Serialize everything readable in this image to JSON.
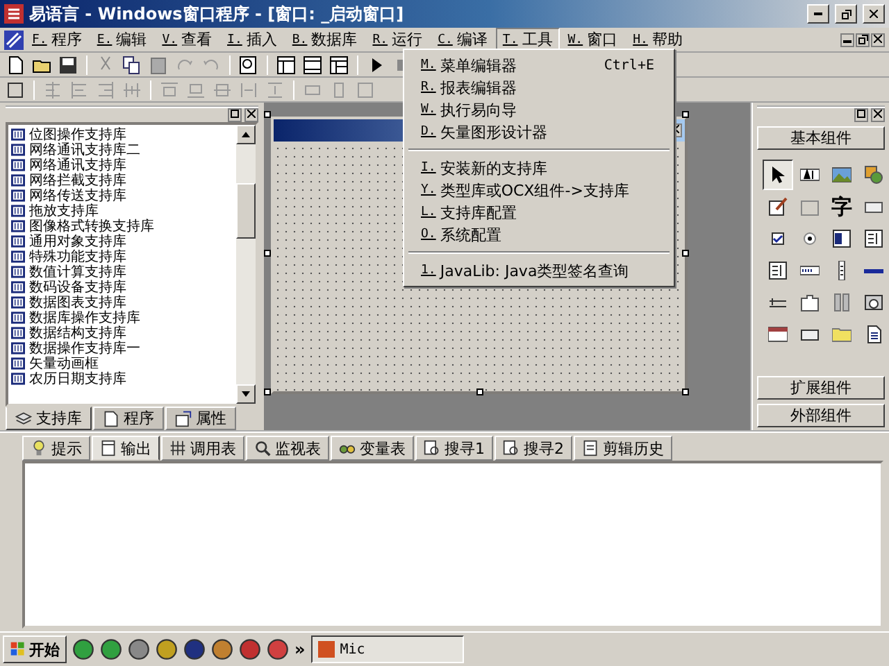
{
  "window": {
    "title": "易语言 - Windows窗口程序 - [窗口: _启动窗口]"
  },
  "menus": [
    {
      "key": "F.",
      "label": "程序",
      "selected": false
    },
    {
      "key": "E.",
      "label": "编辑",
      "selected": false
    },
    {
      "key": "V.",
      "label": "查看",
      "selected": false
    },
    {
      "key": "I.",
      "label": "插入",
      "selected": false
    },
    {
      "key": "B.",
      "label": "数据库",
      "selected": false
    },
    {
      "key": "R.",
      "label": "运行",
      "selected": false
    },
    {
      "key": "C.",
      "label": "编译",
      "selected": false
    },
    {
      "key": "T.",
      "label": "工具",
      "selected": true
    },
    {
      "key": "W.",
      "label": "窗口",
      "selected": false
    },
    {
      "key": "H.",
      "label": "帮助",
      "selected": false
    }
  ],
  "tools_menu": [
    {
      "kind": "item",
      "key": "M.",
      "label": "菜单编辑器",
      "shortcut": "Ctrl+E"
    },
    {
      "kind": "item",
      "key": "R.",
      "label": "报表编辑器"
    },
    {
      "kind": "item",
      "key": "W.",
      "label": "执行易向导"
    },
    {
      "kind": "item",
      "key": "D.",
      "label": "矢量图形设计器"
    },
    {
      "kind": "separator"
    },
    {
      "kind": "item",
      "key": "I.",
      "label": "安装新的支持库"
    },
    {
      "kind": "item",
      "key": "Y.",
      "label": "类型库或OCX组件->支持库"
    },
    {
      "kind": "item",
      "key": "L.",
      "label": "支持库配置"
    },
    {
      "kind": "item",
      "key": "O.",
      "label": "系统配置"
    },
    {
      "kind": "separator"
    },
    {
      "kind": "item",
      "key": "1.",
      "label": "JavaLib: Java类型签名查询"
    }
  ],
  "library_panel": {
    "items": [
      "位图操作支持库",
      "网络通讯支持库二",
      "网络通讯支持库",
      "网络拦截支持库",
      "网络传送支持库",
      "拖放支持库",
      "图像格式转换支持库",
      "通用对象支持库",
      "特殊功能支持库",
      "数值计算支持库",
      "数码设备支持库",
      "数据图表支持库",
      "数据库操作支持库",
      "数据结构支持库",
      "数据操作支持库一",
      "矢量动画框",
      "农历日期支持库"
    ],
    "tabs": [
      {
        "label": "支持库",
        "selected": true
      },
      {
        "label": "程序",
        "selected": false
      },
      {
        "label": "属性",
        "selected": false
      }
    ]
  },
  "palette": {
    "basic": "基本组件",
    "items": [
      {
        "kind": "pointer",
        "selected": true
      },
      {
        "kind": "label",
        "selected": false
      },
      {
        "kind": "picture",
        "selected": false
      },
      {
        "kind": "shapes",
        "selected": false
      },
      {
        "kind": "edit",
        "selected": false
      },
      {
        "kind": "frame",
        "selected": false
      },
      {
        "kind": "glyph",
        "glyph": "字",
        "selected": false
      },
      {
        "kind": "button",
        "selected": false
      },
      {
        "kind": "checkbox",
        "selected": false
      },
      {
        "kind": "radio",
        "selected": false
      },
      {
        "kind": "combo",
        "selected": false
      },
      {
        "kind": "list",
        "selected": false
      },
      {
        "kind": "list",
        "selected": false
      },
      {
        "kind": "hbar",
        "selected": false
      },
      {
        "kind": "vbar",
        "selected": false
      },
      {
        "kind": "hscroll",
        "selected": false
      },
      {
        "kind": "slider",
        "selected": false
      },
      {
        "kind": "tab",
        "selected": false
      },
      {
        "kind": "split",
        "selected": false
      },
      {
        "kind": "camera",
        "selected": false
      },
      {
        "kind": "calendar",
        "selected": false
      },
      {
        "kind": "panel",
        "selected": false
      },
      {
        "kind": "folder",
        "selected": false
      },
      {
        "kind": "document",
        "selected": false
      }
    ],
    "extended": "扩展组件",
    "external": "外部组件"
  },
  "output_panel": {
    "tabs": [
      {
        "label": "提示",
        "selected": false
      },
      {
        "label": "输出",
        "selected": true
      },
      {
        "label": "调用表",
        "selected": false
      },
      {
        "label": "监视表",
        "selected": false
      },
      {
        "label": "变量表",
        "selected": false
      },
      {
        "label": "搜寻1",
        "selected": false
      },
      {
        "label": "搜寻2",
        "selected": false
      },
      {
        "label": "剪辑历史",
        "selected": false
      }
    ]
  },
  "taskbar": {
    "start": "开始",
    "more": "»",
    "tasks": [
      "Mic"
    ]
  }
}
